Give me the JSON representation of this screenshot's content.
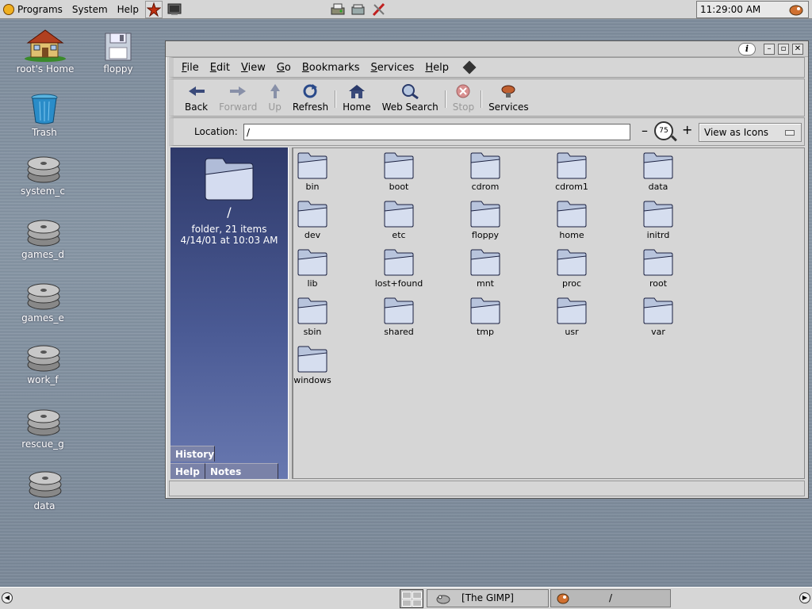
{
  "top_panel": {
    "menus": [
      "Programs",
      "System",
      "Help"
    ],
    "clock": "11:29:00 AM"
  },
  "desktop": {
    "icons": [
      {
        "label": "root's Home",
        "icon": "home-icon"
      },
      {
        "label": "floppy",
        "icon": "floppy-icon"
      },
      {
        "label": "Trash",
        "icon": "trash-icon"
      },
      {
        "label": "system_c",
        "icon": "hard-drive-icon"
      },
      {
        "label": "games_d",
        "icon": "hard-drive-icon"
      },
      {
        "label": "games_e",
        "icon": "hard-drive-icon"
      },
      {
        "label": "work_f",
        "icon": "hard-drive-icon"
      },
      {
        "label": "rescue_g",
        "icon": "hard-drive-icon"
      },
      {
        "label": "data",
        "icon": "hard-drive-icon"
      }
    ]
  },
  "window": {
    "menu": {
      "file": "F",
      "file_rest": "ile",
      "edit": "E",
      "edit_rest": "dit",
      "view": "V",
      "view_rest": "iew",
      "go": "G",
      "go_rest": "o",
      "bookmarks": "B",
      "bookmarks_rest": "ookmarks",
      "services": "S",
      "services_rest": "ervices",
      "help": "H",
      "help_rest": "elp"
    },
    "toolbar": {
      "back": "Back",
      "forward": "Forward",
      "up": "Up",
      "refresh": "Refresh",
      "home": "Home",
      "web_search": "Web Search",
      "stop": "Stop",
      "services": "Services"
    },
    "location": {
      "label": "Location:",
      "value": "/",
      "zoom": "75",
      "view_as": "View as Icons"
    },
    "sidebar": {
      "path": "/",
      "info_line1": "folder, 21 items",
      "info_line2": "4/14/01 at 10:03 AM",
      "tabs": {
        "history": "History",
        "help": "Help",
        "notes": "Notes"
      }
    },
    "files": [
      "bin",
      "boot",
      "cdrom",
      "cdrom1",
      "data",
      "dev",
      "etc",
      "floppy",
      "home",
      "initrd",
      "lib",
      "lost+found",
      "mnt",
      "proc",
      "root",
      "sbin",
      "shared",
      "tmp",
      "usr",
      "var",
      "windows"
    ]
  },
  "bottom_panel": {
    "tasks": [
      {
        "label": "[The GIMP]",
        "icon": "gimp-icon"
      },
      {
        "label": "/",
        "icon": "nautilus-icon"
      }
    ]
  }
}
